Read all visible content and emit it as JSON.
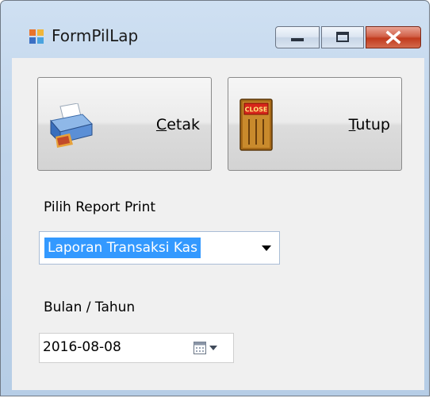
{
  "window": {
    "title": "FormPilLap",
    "controls": [
      "minimize",
      "maximize",
      "close"
    ]
  },
  "buttons": {
    "cetak": {
      "label_underlined": "C",
      "label_rest": "etak",
      "icon": "printer-icon"
    },
    "tutup": {
      "label_underlined": "T",
      "label_rest": "utup",
      "icon": "close-door-icon",
      "icon_text": "CLOSE"
    }
  },
  "report": {
    "label": "Pilih Report Print",
    "selected": "Laporan Transaksi Kas"
  },
  "period": {
    "label": "Bulan / Tahun",
    "value": "2016-08-08"
  }
}
